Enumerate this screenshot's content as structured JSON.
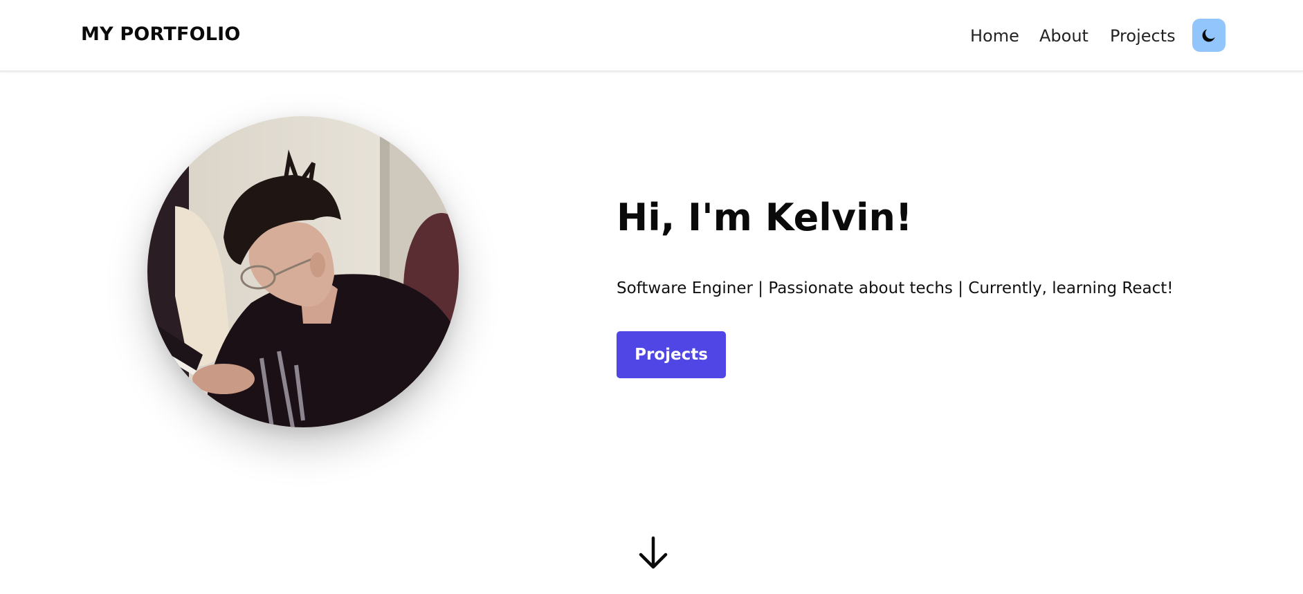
{
  "header": {
    "brand": "MY PORTFOLIO",
    "nav": [
      {
        "label": "Home"
      },
      {
        "label": "About"
      },
      {
        "label": "Projects"
      }
    ],
    "theme_toggle_icon": "moon-icon",
    "theme_toggle_color": "#93c5fd"
  },
  "hero": {
    "title": "Hi, I'm Kelvin!",
    "subtitle": "Software Enginer | Passionate about techs | Currently, learning React!",
    "button_label": "Projects",
    "button_color": "#4f46e5",
    "scroll_icon": "arrow-down-icon"
  }
}
